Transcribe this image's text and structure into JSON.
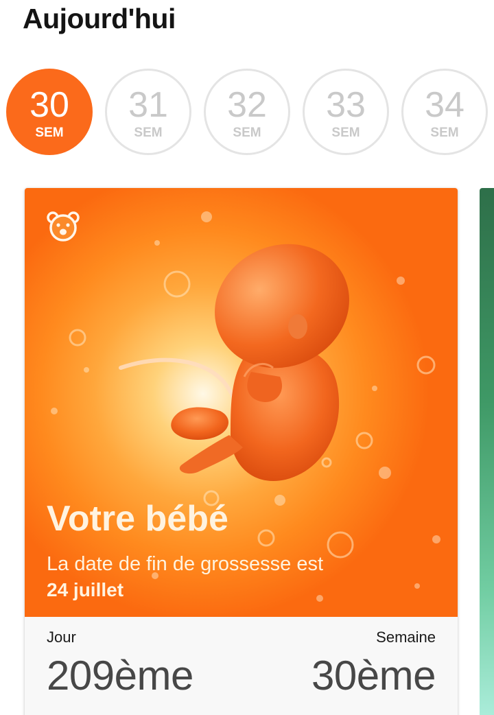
{
  "header": {
    "title": "Aujourd'hui"
  },
  "weeks": [
    {
      "number": "30",
      "unit": "SEM",
      "selected": true
    },
    {
      "number": "31",
      "unit": "SEM",
      "selected": false
    },
    {
      "number": "32",
      "unit": "SEM",
      "selected": false
    },
    {
      "number": "33",
      "unit": "SEM",
      "selected": false
    },
    {
      "number": "34",
      "unit": "SEM",
      "selected": false
    }
  ],
  "card": {
    "icon": "bear-icon",
    "title": "Votre bébé",
    "description": "La date de fin de grossesse est",
    "due_date": "24 juillet",
    "stats": {
      "day_label": "Jour",
      "day_value": "209ème",
      "week_label": "Semaine",
      "week_value": "30ème"
    }
  },
  "colors": {
    "accent": "#fb6a1b",
    "inactive_circle": "#e4e4e4",
    "inactive_text": "#c9c9c9",
    "next_card": "#3f9966"
  }
}
